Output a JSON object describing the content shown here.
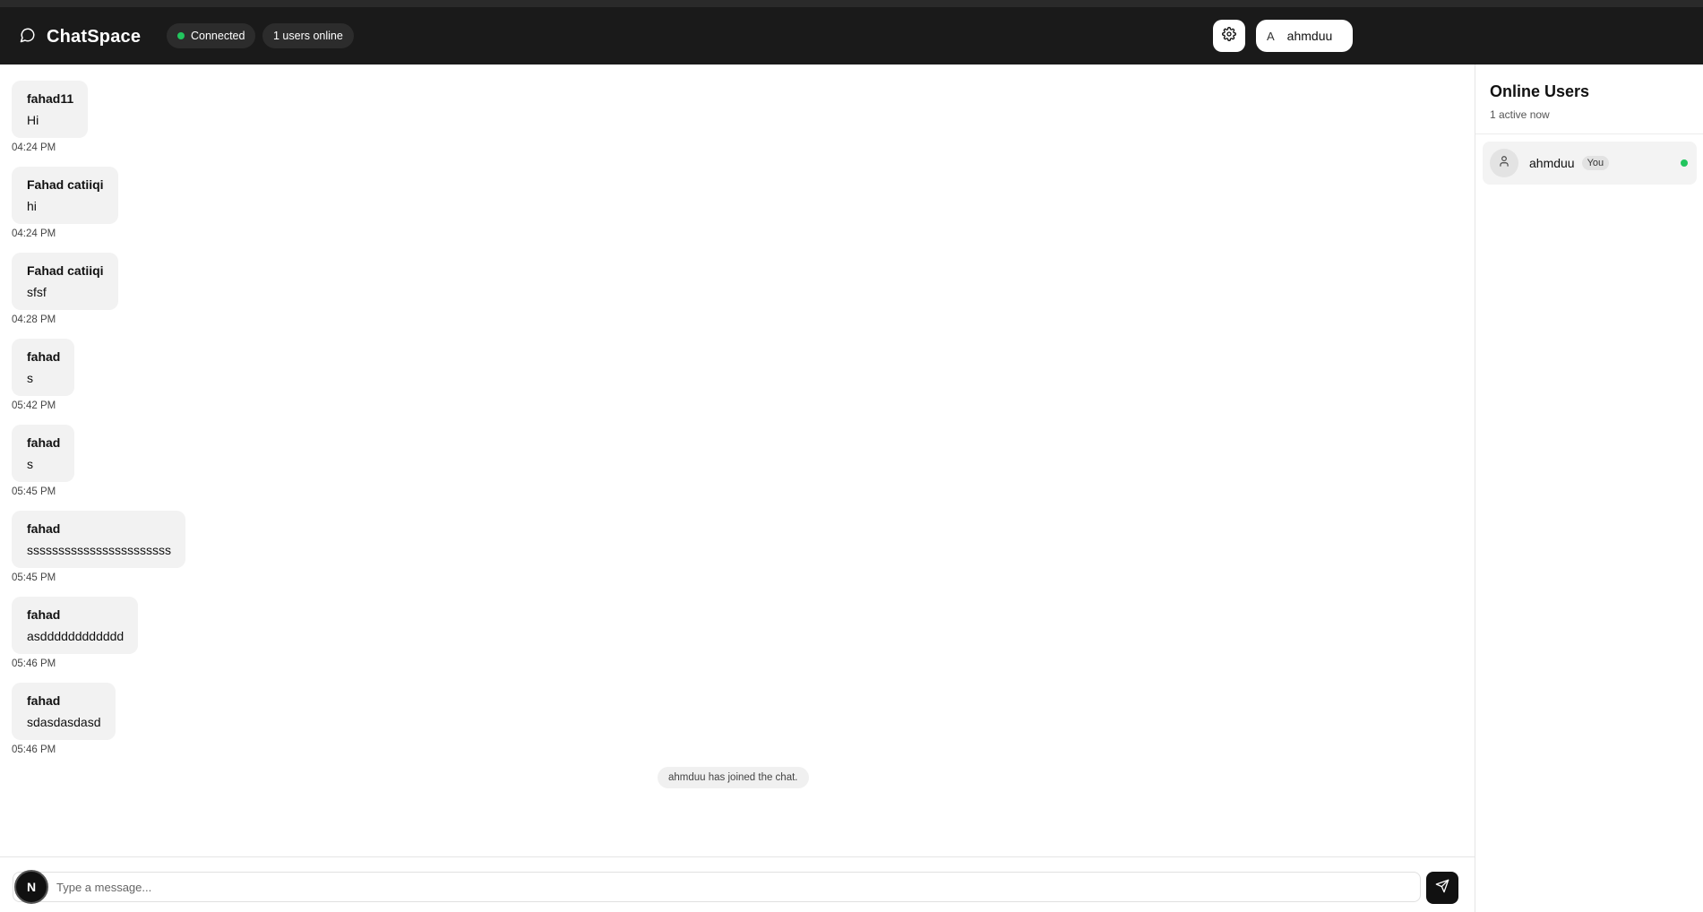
{
  "header": {
    "brand": "ChatSpace",
    "status_label": "Connected",
    "online_label": "1 users online",
    "user_initial": "A",
    "user_name": "ahmduu"
  },
  "messages": [
    {
      "sender": "fahad11",
      "text": "Hi",
      "time": "04:24 PM"
    },
    {
      "sender": "Fahad catiiqi",
      "text": "hi",
      "time": "04:24 PM"
    },
    {
      "sender": "Fahad catiiqi",
      "text": "sfsf",
      "time": "04:28 PM"
    },
    {
      "sender": "fahad",
      "text": "s",
      "time": "05:42 PM"
    },
    {
      "sender": "fahad",
      "text": "s",
      "time": "05:45 PM"
    },
    {
      "sender": "fahad",
      "text": "sssssssssssssssssssssss",
      "time": "05:45 PM"
    },
    {
      "sender": "fahad",
      "text": "asdddddddddddd",
      "time": "05:46 PM"
    },
    {
      "sender": "fahad",
      "text": "sdasdasdasd",
      "time": "05:46 PM"
    }
  ],
  "system_message": "ahmduu has joined the chat.",
  "composer": {
    "placeholder": "Type a message...",
    "badge": "N"
  },
  "sidebar": {
    "title": "Online Users",
    "subtitle": "1 active now",
    "users": [
      {
        "name": "ahmduu",
        "badge": "You"
      }
    ]
  },
  "colors": {
    "header_bg": "#1a1a1a",
    "online": "#22c55e",
    "bubble_bg": "#f2f2f2"
  }
}
